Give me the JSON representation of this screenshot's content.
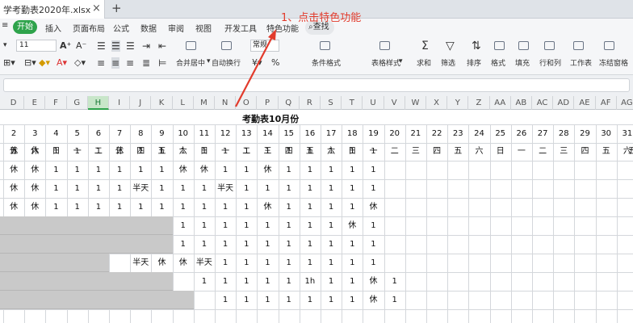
{
  "tab": {
    "title": "学考勤表2020年.xlsx",
    "close": "×",
    "new": "+"
  },
  "menu": {
    "items": [
      "开始",
      "插入",
      "页面布局",
      "公式",
      "数据",
      "审阅",
      "视图",
      "开发工具",
      "特色功能"
    ],
    "search": "查找"
  },
  "toolbar": {
    "font_size": "11",
    "format_value": "常规",
    "merge_label": "合并居中",
    "wrap_label": "自动换行",
    "cond_label": "条件格式",
    "table_style_label": "表格样式",
    "sum_label": "求和",
    "filter_label": "筛选",
    "sort_label": "排序",
    "format_label": "格式",
    "fill_label": "填充",
    "rowcol_label": "行和列",
    "sheet_label": "工作表",
    "freeze_label": "冻结窗格",
    "percent": "%"
  },
  "annotation": {
    "text": "1、点击特色功能",
    "color": "#e23b2c"
  },
  "columns": [
    "D",
    "E",
    "F",
    "G",
    "H",
    "I",
    "J",
    "K",
    "L",
    "M",
    "N",
    "O",
    "P",
    "Q",
    "R",
    "S",
    "T",
    "U",
    "V",
    "W",
    "X",
    "Y",
    "Z",
    "AA",
    "AB",
    "AC",
    "AD",
    "AE",
    "AF",
    "AG"
  ],
  "selected_column": "H",
  "sheet": {
    "title": "考勤表10月份",
    "days": [
      "2",
      "3",
      "4",
      "5",
      "6",
      "7",
      "8",
      "9",
      "10",
      "11",
      "12",
      "13",
      "14",
      "15",
      "16",
      "17",
      "18",
      "19",
      "20",
      "21",
      "22",
      "23",
      "24",
      "25",
      "26",
      "27",
      "28",
      "29",
      "30",
      "31"
    ],
    "weekdays": [
      "五",
      "六",
      "日",
      "一",
      "二",
      "三",
      "四",
      "五",
      "六",
      "日",
      "一",
      "二",
      "三",
      "四",
      "五",
      "六",
      "日",
      "一",
      "二",
      "三",
      "四",
      "五",
      "六",
      "日",
      "一",
      "二",
      "三",
      "四",
      "五",
      "六"
    ],
    "row_edge": "五",
    "rows": [
      [
        "休",
        "休",
        "1",
        "1",
        "1",
        "休",
        "1",
        "1",
        "1",
        "1",
        "1",
        "1",
        "1",
        "1",
        "1",
        "1",
        "1",
        "1"
      ],
      [
        "休",
        "休",
        "1",
        "1",
        "1",
        "1",
        "1",
        "1",
        "休",
        "休",
        "1",
        "1",
        "休",
        "1",
        "1",
        "1",
        "1",
        "1"
      ],
      [
        "休",
        "休",
        "1",
        "1",
        "1",
        "1",
        "半天",
        "1",
        "1",
        "1",
        "半天",
        "1",
        "1",
        "1",
        "1",
        "1",
        "1",
        "1"
      ],
      [
        "休",
        "休",
        "1",
        "1",
        "1",
        "1",
        "1",
        "1",
        "1",
        "1",
        "1",
        "1",
        "休",
        "1",
        "1",
        "1",
        "1",
        "休"
      ],
      [
        "",
        "",
        "",
        "",
        "",
        "",
        "",
        "",
        "1",
        "1",
        "1",
        "1",
        "1",
        "1",
        "1",
        "1",
        "休",
        "1"
      ],
      [
        "",
        "",
        "",
        "",
        "",
        "",
        "",
        "",
        "1",
        "1",
        "1",
        "1",
        "1",
        "1",
        "1",
        "1",
        "1",
        "1"
      ],
      [
        "",
        "",
        "",
        "",
        "",
        "",
        "半天",
        "休",
        "休",
        "半天",
        "1",
        "1",
        "1",
        "1",
        "1",
        "1",
        "1",
        "1"
      ],
      [
        "",
        "",
        "",
        "",
        "",
        "",
        "",
        "",
        "",
        "1",
        "1",
        "1",
        "1",
        "1",
        "1h",
        "1",
        "1",
        "休",
        "1"
      ],
      [
        "",
        "",
        "",
        "",
        "",
        "",
        "",
        "",
        "",
        "",
        "1",
        "1",
        "1",
        "1",
        "1",
        "1",
        "1",
        "休",
        "1"
      ]
    ]
  }
}
